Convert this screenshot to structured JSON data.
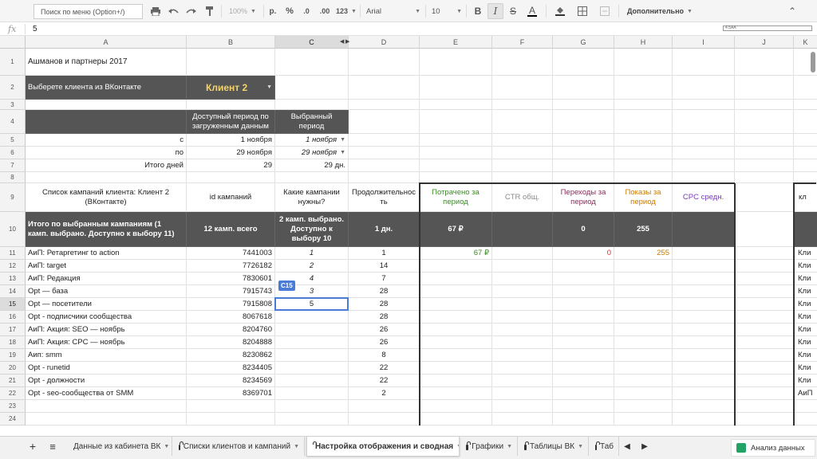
{
  "toolbar": {
    "menu_search": "Поиск по меню (Option+/)",
    "zoom": "100%",
    "currency": "р.",
    "percent": "%",
    "dec_decrease": ".0",
    "dec_increase": ".00",
    "format_more": "123",
    "font": "Arial",
    "font_size": "10",
    "bold": "B",
    "italic": "I",
    "strike": "S",
    "text_color": "A",
    "more": "Дополнительно",
    "collapse": "⌃"
  },
  "formula_bar": {
    "fx": "fx",
    "value": "5",
    "mini": "4.5AA"
  },
  "columns": [
    "A",
    "B",
    "C",
    "D",
    "E",
    "F",
    "G",
    "H",
    "I",
    "J",
    "K"
  ],
  "rows": [
    "1",
    "2",
    "3",
    "4",
    "5",
    "6",
    "7",
    "8",
    "9",
    "10",
    "11",
    "12",
    "13",
    "14",
    "15",
    "16",
    "17",
    "18",
    "19",
    "20",
    "21",
    "22",
    "23",
    "24"
  ],
  "sheet": {
    "title": "Ашманов и партнеры 2017",
    "choose_client_label": "Выберете клиента из ВКонтакте",
    "client_value": "Клиент 2",
    "period_hdr_available": "Доступный период по загруженным данным",
    "period_hdr_selected": "Выбранный период",
    "from_label": "с",
    "from_available": "1 ноября",
    "from_selected": "1 ноября",
    "to_label": "по",
    "to_available": "29 ноября",
    "to_selected": "29 ноября",
    "days_label": "Итого дней",
    "days_available": "29",
    "days_selected": "29 дн.",
    "hdr_campaigns": "Список кампаний клиента: Клиент 2 (ВКонтакте)",
    "hdr_id": "id кампаний",
    "hdr_needed": "Какие кампании нужны?",
    "hdr_duration": "Продолжительность",
    "hdr_spent": "Потрачено за период",
    "hdr_ctr": "CTR общ.",
    "hdr_clicks": "Переходы за период",
    "hdr_impr": "Показы за период",
    "hdr_cpc": "CPC средн.",
    "hdr_k_partial": "кл",
    "total_label": "Итого по выбранным кампаниям (1 камп. выбрано. Доступно к выбору 11)",
    "total_id": "12 камп. всего",
    "total_needed": "2 камп. выбрано. Доступно к выбору 10",
    "total_duration": "1 дн.",
    "total_spent": "67 ₽",
    "total_clicks": "0",
    "total_impr": "255",
    "campaigns": [
      {
        "name": "АиП: Ретаргетинг to action",
        "id": "7441003",
        "needed": "1",
        "dur": "1",
        "spent": "67 ₽",
        "clicks": "0",
        "impr": "255",
        "k": "Кли"
      },
      {
        "name": "АиП: target",
        "id": "7726182",
        "needed": "2",
        "dur": "14",
        "spent": "",
        "clicks": "",
        "impr": "",
        "k": "Кли"
      },
      {
        "name": "АиП: Редакция",
        "id": "7830601",
        "needed": "4",
        "dur": "7",
        "spent": "",
        "clicks": "",
        "impr": "",
        "k": "Кли"
      },
      {
        "name": "Opt — база",
        "id": "7915743",
        "needed": "3",
        "dur": "28",
        "spent": "",
        "clicks": "",
        "impr": "",
        "k": "Кли"
      },
      {
        "name": "Opt — посетители",
        "id": "7915808",
        "needed": "5",
        "dur": "28",
        "spent": "",
        "clicks": "",
        "impr": "",
        "k": "Кли"
      },
      {
        "name": "Opt - подписчики сообщества",
        "id": "8067618",
        "needed": "",
        "dur": "28",
        "spent": "",
        "clicks": "",
        "impr": "",
        "k": "Кли"
      },
      {
        "name": "АиП: Акция: SEO — ноябрь",
        "id": "8204760",
        "needed": "",
        "dur": "26",
        "spent": "",
        "clicks": "",
        "impr": "",
        "k": "Кли"
      },
      {
        "name": "АиП: Акция: CPC — ноябрь",
        "id": "8204888",
        "needed": "",
        "dur": "26",
        "spent": "",
        "clicks": "",
        "impr": "",
        "k": "Кли"
      },
      {
        "name": "Аип: smm",
        "id": "8230862",
        "needed": "",
        "dur": "8",
        "spent": "",
        "clicks": "",
        "impr": "",
        "k": "Кли"
      },
      {
        "name": "Opt - runetid",
        "id": "8234405",
        "needed": "",
        "dur": "22",
        "spent": "",
        "clicks": "",
        "impr": "",
        "k": "Кли"
      },
      {
        "name": "Opt - должности",
        "id": "8234569",
        "needed": "",
        "dur": "22",
        "spent": "",
        "clicks": "",
        "impr": "",
        "k": "Кли"
      },
      {
        "name": "Opt - seo-сообщества от SMM",
        "id": "8369701",
        "needed": "",
        "dur": "2",
        "spent": "",
        "clicks": "",
        "impr": "",
        "k": "АиП"
      }
    ],
    "active_cell_tag": "C15"
  },
  "tabs": {
    "add": "+",
    "list": "≡",
    "items": [
      {
        "label": "Данные из кабинета ВК",
        "locked": false
      },
      {
        "label": "Списки клиентов и кампаний",
        "locked": true
      },
      {
        "label": "Настройка отображения и сводная",
        "locked": true
      },
      {
        "label": "Графики",
        "locked": true
      },
      {
        "label": "Таблицы ВК",
        "locked": true
      },
      {
        "label": "Таб",
        "locked": true
      }
    ],
    "explore": "Анализ данных"
  },
  "colors": {
    "spent": "#3a8a24",
    "ctr": "#8a8a8a",
    "clicks": "#8a2a5a",
    "impr": "#c77a00",
    "cpc": "#7a3ac0",
    "accent": "#4a7bd6",
    "client_dd": "#f3d46b"
  }
}
